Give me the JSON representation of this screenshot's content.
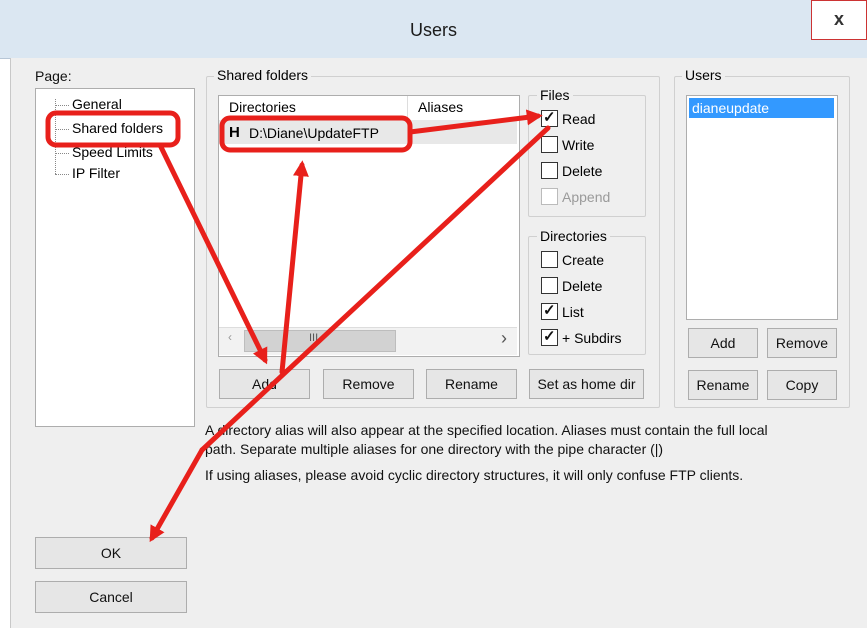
{
  "window": {
    "title": "Users",
    "close": "x"
  },
  "page_panel": {
    "label": "Page:",
    "items": [
      "General",
      "Shared folders",
      "Speed Limits",
      "IP Filter"
    ]
  },
  "shared_folders": {
    "group_title": "Shared folders",
    "columns": [
      "Directories",
      "Aliases"
    ],
    "rows": [
      {
        "prefix": "H",
        "directory": "D:\\Diane\\UpdateFTP",
        "alias": ""
      }
    ],
    "scroll_glyph": "III",
    "scroll_right": "›",
    "buttons": {
      "add": "Add",
      "remove": "Remove",
      "rename": "Rename",
      "set_home": "Set as home dir"
    }
  },
  "files": {
    "title": "Files",
    "options": [
      {
        "label": "Read",
        "checked": true,
        "enabled": true
      },
      {
        "label": "Write",
        "checked": false,
        "enabled": true
      },
      {
        "label": "Delete",
        "checked": false,
        "enabled": true
      },
      {
        "label": "Append",
        "checked": false,
        "enabled": false
      }
    ]
  },
  "directories": {
    "title": "Directories",
    "options": [
      {
        "label": "Create",
        "checked": false
      },
      {
        "label": "Delete",
        "checked": false
      },
      {
        "label": "List",
        "checked": true
      },
      {
        "label": "+ Subdirs",
        "checked": true
      }
    ]
  },
  "users": {
    "title": "Users",
    "list": [
      "dianeupdate"
    ],
    "buttons": {
      "add": "Add",
      "remove": "Remove",
      "rename": "Rename",
      "copy": "Copy"
    }
  },
  "info": {
    "line1": "A directory alias will also appear at the specified location. Aliases must contain the full local",
    "line2": "path. Separate multiple aliases for one directory with the pipe character (|)",
    "line3": "If using aliases, please avoid cyclic directory structures, it will only confuse FTP clients."
  },
  "dialog_buttons": {
    "ok": "OK",
    "cancel": "Cancel"
  },
  "annotation": {
    "color": "#e8201b"
  }
}
